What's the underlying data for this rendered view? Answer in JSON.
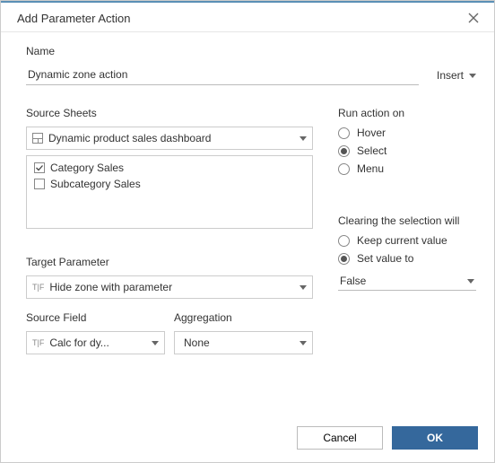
{
  "titlebar": {
    "title": "Add Parameter Action"
  },
  "name": {
    "label": "Name",
    "value": "Dynamic zone action",
    "insert": "Insert"
  },
  "source_sheets": {
    "label": "Source Sheets",
    "workbook": "Dynamic product sales dashboard",
    "sheets": [
      {
        "label": "Category Sales",
        "checked": true
      },
      {
        "label": "Subcategory Sales",
        "checked": false
      }
    ]
  },
  "run_on": {
    "label": "Run action on",
    "options": [
      "Hover",
      "Select",
      "Menu"
    ],
    "selected": "Select"
  },
  "target_parameter": {
    "label": "Target Parameter",
    "value": "Hide zone with parameter"
  },
  "source_field": {
    "label": "Source Field",
    "value": "Calc for dy..."
  },
  "aggregation": {
    "label": "Aggregation",
    "value": "None"
  },
  "clearing": {
    "label": "Clearing the selection will",
    "options": [
      "Keep current value",
      "Set value to"
    ],
    "selected": "Set value to",
    "value": "False"
  },
  "footer": {
    "cancel": "Cancel",
    "ok": "OK"
  }
}
